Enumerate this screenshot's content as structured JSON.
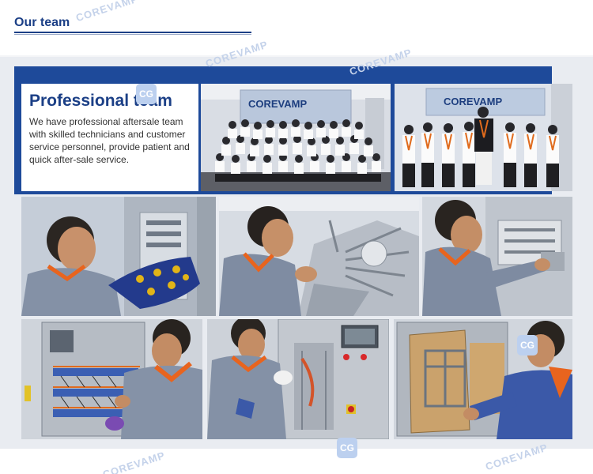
{
  "header": {
    "title": "Our team"
  },
  "info": {
    "title": "Professional team",
    "description": "We have professional aftersale team with skilled technicians and customer service personnel, provide patient and quick after-sale service."
  },
  "signage": {
    "logo": "COREVAMP"
  },
  "watermark": {
    "text": "COREVAMP",
    "badge": "CG"
  },
  "colors": {
    "brand_blue": "#1b3f86",
    "band_blue": "#1e4a9a",
    "uniform_orange": "#e8641e",
    "uniform_grey": "#8a98ad"
  }
}
